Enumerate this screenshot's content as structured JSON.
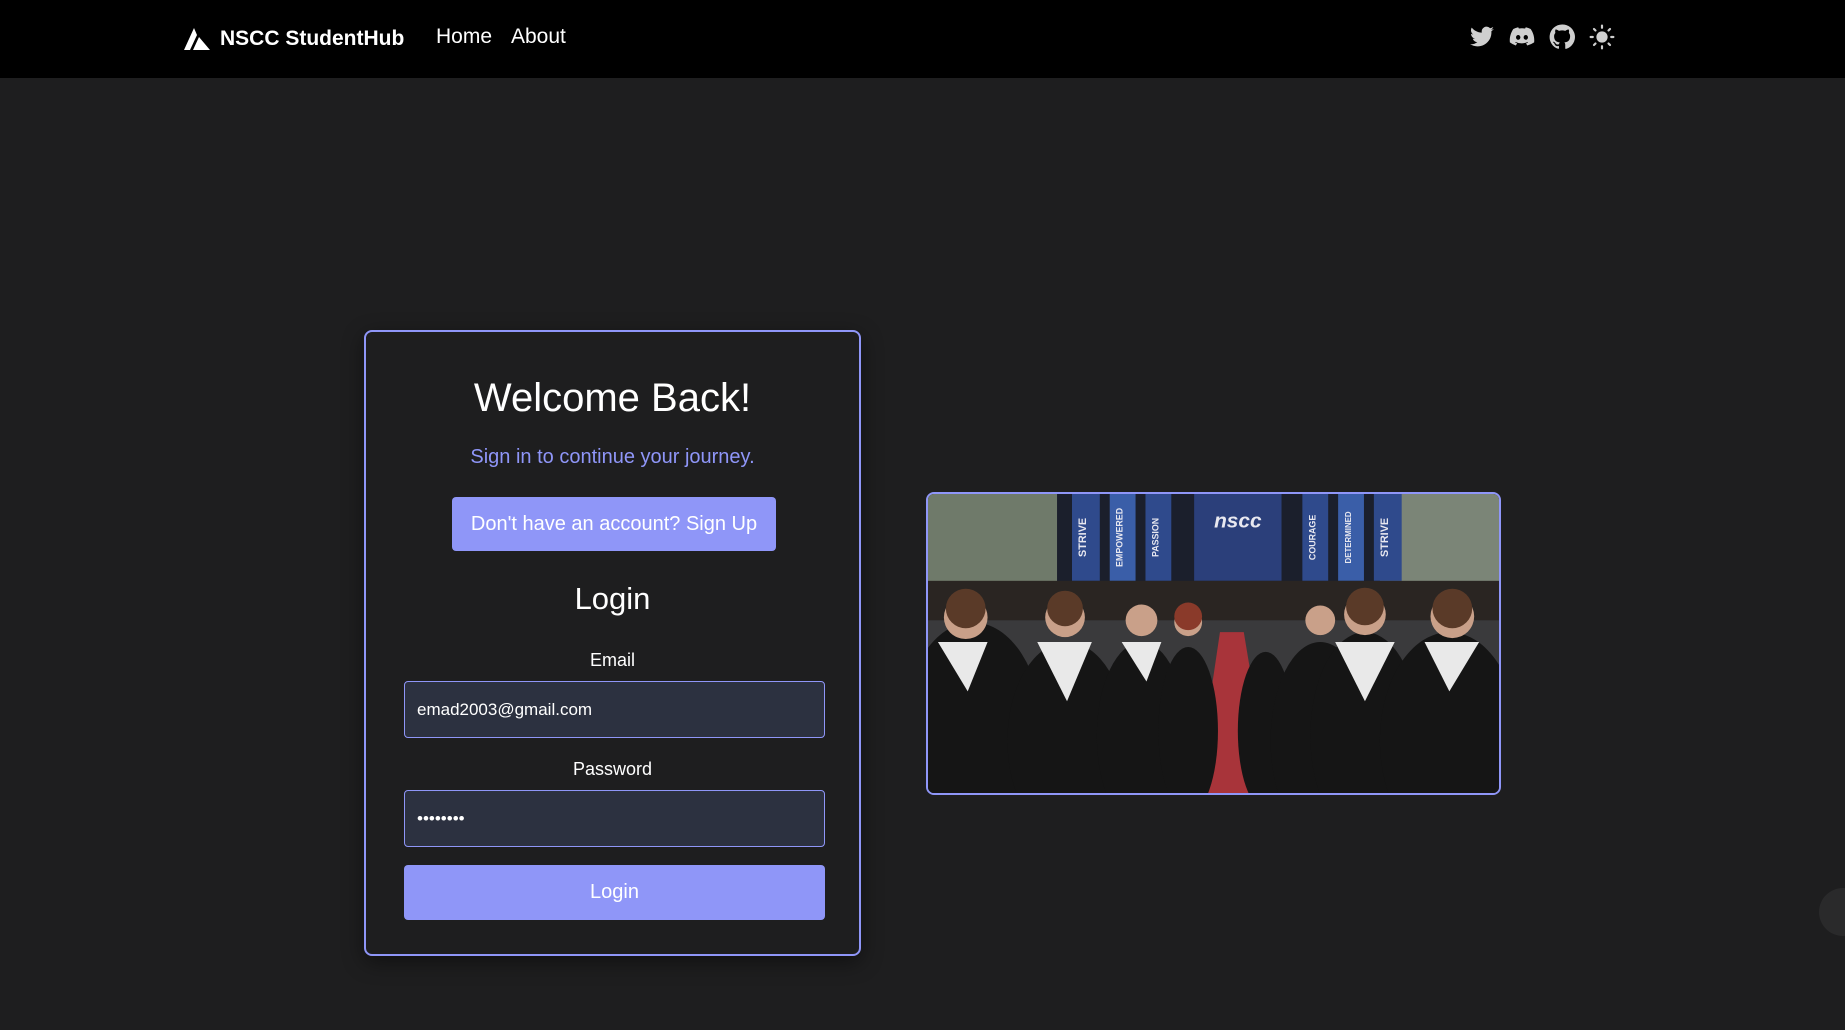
{
  "navbar": {
    "brand": "NSCC StudentHub",
    "links": [
      "Home",
      "About"
    ],
    "icons": [
      "twitter-icon",
      "discord-icon",
      "github-icon",
      "theme-toggle-icon"
    ]
  },
  "login_card": {
    "title": "Welcome Back!",
    "subtitle": "Sign in to continue your journey.",
    "signup_button": "Don't have an account? Sign Up",
    "form_title": "Login",
    "email_label": "Email",
    "email_value": "emad2003@gmail.com",
    "password_label": "Password",
    "password_value": "••••••••",
    "login_button": "Login"
  },
  "photo": {
    "banners": [
      "STRIVE",
      "EMPOWERED",
      "PASSION",
      "nscc",
      "COURAGE",
      "DETERMINED",
      "STRIVE"
    ]
  },
  "colors": {
    "accent": "#8f96f8",
    "background": "#1e1e1f",
    "navbar": "#000000",
    "input_bg": "#2c3140"
  }
}
